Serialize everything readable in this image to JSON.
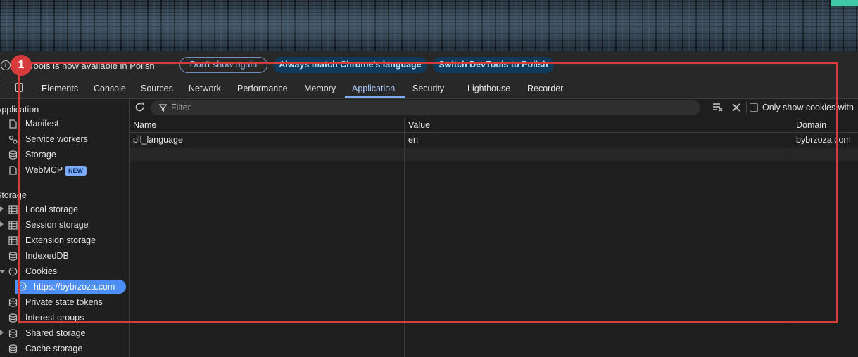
{
  "infobar": {
    "message": "DevTools is now available in Polish",
    "dont_show_again": "Don't show again",
    "always_match": "Always match Chrome's language",
    "switch_lang": "Switch DevTools to Polish"
  },
  "tabs": [
    "Elements",
    "Console",
    "Sources",
    "Network",
    "Performance",
    "Memory",
    "Application",
    "Security",
    "Lighthouse",
    "Recorder"
  ],
  "active_tab": "Application",
  "sidebar": {
    "section_application": "Application",
    "app_items": [
      "Manifest",
      "Service workers",
      "Storage",
      "WebMCP"
    ],
    "new_badge": "NEW",
    "section_storage": "Storage",
    "storage_items": [
      "Local storage",
      "Session storage",
      "Extension storage",
      "IndexedDB",
      "Cookies"
    ],
    "cookie_origin": "https://bybrzoza.com",
    "more_items": [
      "Private state tokens",
      "Interest groups",
      "Shared storage",
      "Cache storage"
    ]
  },
  "toolbar": {
    "filter_placeholder": "Filter",
    "only_show_cookies": "Only show cookies with"
  },
  "table": {
    "columns": [
      "Name",
      "Value",
      "Domain"
    ],
    "rows": [
      {
        "name": "pll_language",
        "value": "en",
        "domain": "bybrzoza.com"
      }
    ]
  },
  "annotation": {
    "number": "1",
    "color": "#d83b3b"
  },
  "colors": {
    "accent": "#a8c7fa",
    "selected": "#4d8ff6",
    "background": "#1e1e1e"
  }
}
